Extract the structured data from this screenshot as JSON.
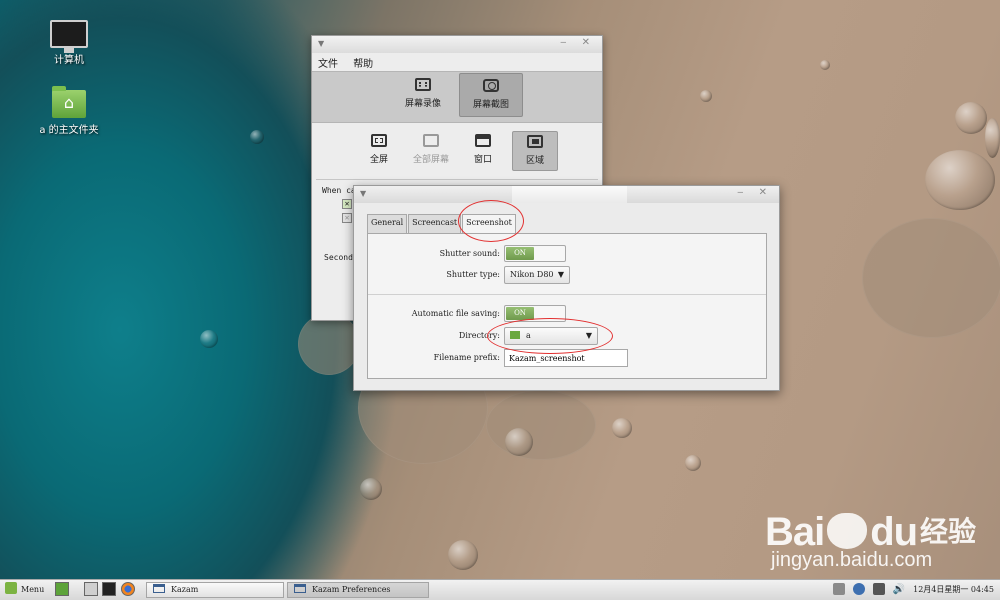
{
  "desktop": {
    "icons": [
      {
        "label": "计算机",
        "icon": "computer-icon"
      },
      {
        "label": "a 的主文件夹",
        "icon": "home-folder-icon"
      }
    ]
  },
  "kazam": {
    "menu": [
      "文件",
      "帮助"
    ],
    "modes": [
      {
        "label": "屏幕录像",
        "icon": "film-icon",
        "active": false
      },
      {
        "label": "屏幕截图",
        "icon": "camera-icon",
        "active": true
      }
    ],
    "capture": [
      {
        "label": "全屏",
        "icon": "fullscreen-icon",
        "state": "normal"
      },
      {
        "label": "全部屏幕",
        "icon": "all-screens-icon",
        "state": "disabled"
      },
      {
        "label": "窗口",
        "icon": "window-icon",
        "state": "normal"
      },
      {
        "label": "区域",
        "icon": "area-icon",
        "state": "active"
      }
    ],
    "include_label": "When capturing include",
    "second_label": "Second"
  },
  "prefs": {
    "tabs": [
      "General",
      "Screencast",
      "Screenshot"
    ],
    "active_tab": "Screenshot",
    "shutter_sound_label": "Shutter sound:",
    "shutter_sound_value": "ON",
    "shutter_type_label": "Shutter type:",
    "shutter_type_value": "Nikon D80",
    "auto_save_label": "Automatic file saving:",
    "auto_save_value": "ON",
    "directory_label": "Directory:",
    "directory_value": "a",
    "prefix_label": "Filename prefix:",
    "prefix_value": "Kazam_screenshot"
  },
  "taskbar": {
    "menu_label": "Menu",
    "windows": [
      {
        "label": "Kazam",
        "active": false
      },
      {
        "label": "Kazam Preferences",
        "active": true
      }
    ],
    "clock": "12月4日星期一  04:45"
  },
  "watermark": {
    "brand": "Bai",
    "brand2": "du",
    "cn": "经验",
    "url": "jingyan.baidu.com"
  },
  "colors": {
    "toggle_on": "#7fa95b",
    "annotation": "#e23030"
  }
}
